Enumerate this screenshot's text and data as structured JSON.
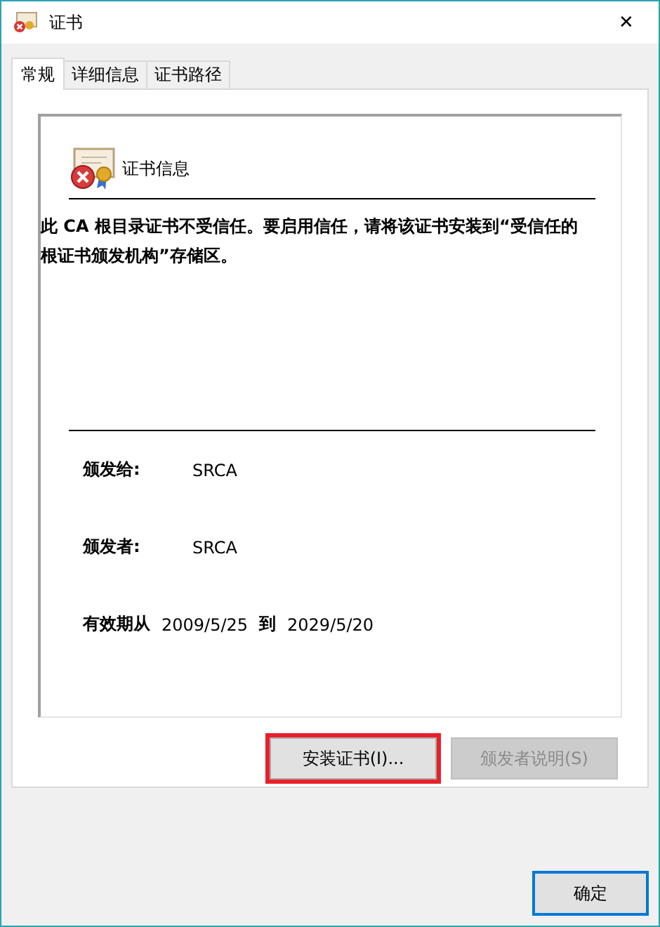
{
  "window": {
    "title": "证书",
    "close": "✕"
  },
  "tabs": [
    {
      "label": "常规",
      "selected": true
    },
    {
      "label": "详细信息",
      "selected": false
    },
    {
      "label": "证书路径",
      "selected": false
    }
  ],
  "info": {
    "title": "证书信息",
    "message": "此 CA 根目录证书不受信任。要启用信任，请将该证书安装到“受信任的根证书颁发机构”存储区。",
    "fields": [
      {
        "label": "颁发给:",
        "value": "SRCA"
      },
      {
        "label": "颁发者:",
        "value": "SRCA"
      }
    ],
    "validity": {
      "label": "有效期从",
      "from": "2009/5/25",
      "to_label": "到",
      "to": "2029/5/20"
    }
  },
  "buttons": [
    {
      "label": "安装证书(I)...",
      "disabled": false,
      "highlighted": true
    },
    {
      "label": "颁发者说明(S)",
      "disabled": true,
      "highlighted": false
    }
  ],
  "footer": {
    "ok": {
      "label": "确定",
      "default": true
    }
  }
}
